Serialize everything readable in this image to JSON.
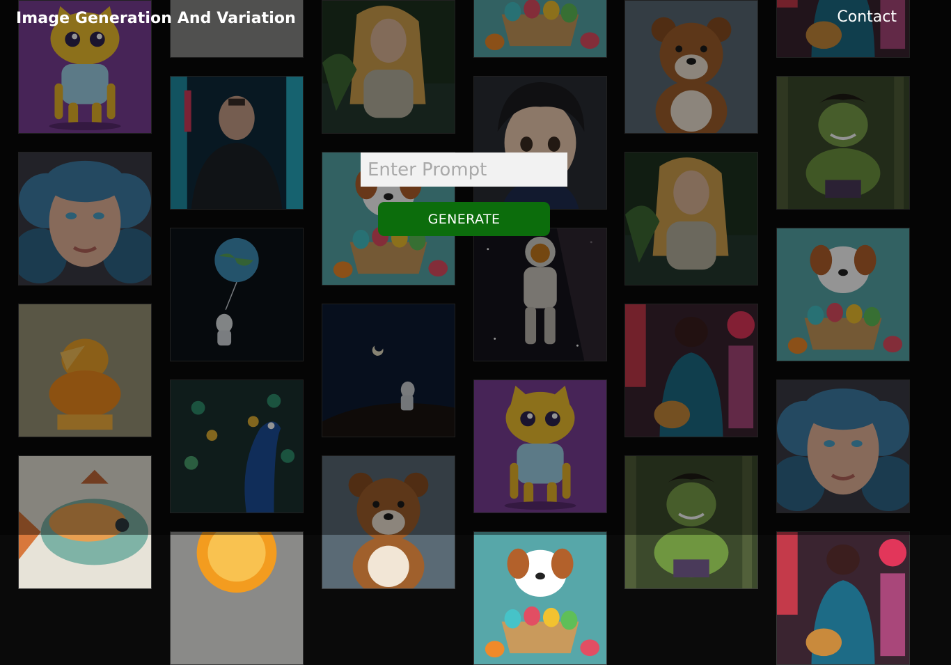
{
  "header": {
    "title": "Image Generation And Variation",
    "contact_label": "Contact"
  },
  "form": {
    "prompt_placeholder": "Enter Prompt",
    "prompt_value": "",
    "generate_label": "GENERATE"
  },
  "colors": {
    "background": "#0a0a0a",
    "generate_button": "#0c6d0c",
    "input_background": "#f2f2f2",
    "text": "#ffffff"
  },
  "gallery": {
    "columns": [
      [
        "cat-cartoon",
        "curly-hair-girl",
        "orange-bird",
        "fish-painting"
      ],
      [
        "orange-slice",
        "man-city-night",
        "astronaut-earth-balloon",
        "peacock"
      ],
      [
        "woman-forest",
        "puppy-easter-basket",
        "astronaut-moon-night",
        "teddy-bear"
      ],
      [
        "puppy-easter-basket",
        "anime-boy",
        "astronaut-space",
        "cat-cartoon"
      ],
      [
        "teddy-bear",
        "woman-forest",
        "anime-boy-city",
        "hulk-cartoon"
      ],
      [
        "anime-boy-city",
        "hulk-cartoon",
        "puppy-easter-basket",
        "curly-hair-girl"
      ]
    ]
  }
}
